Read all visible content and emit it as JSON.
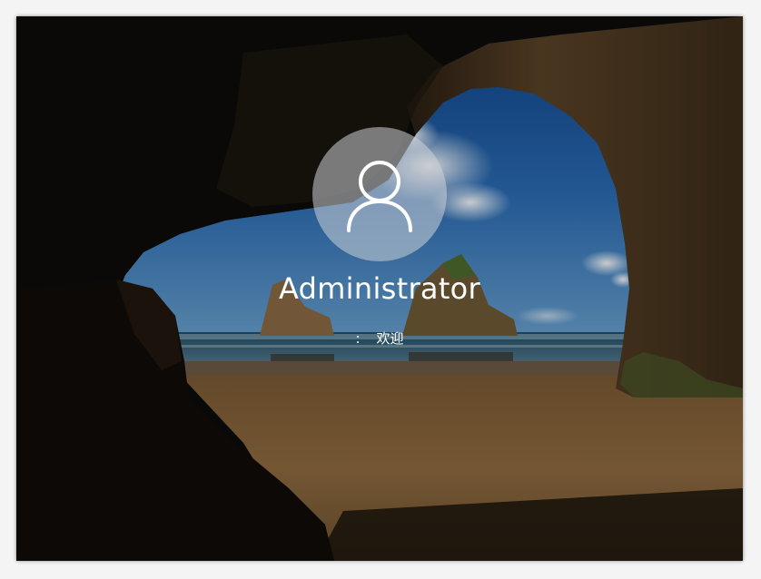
{
  "login": {
    "username": "Administrator",
    "status_prefix": ":",
    "status_text": "欢迎"
  },
  "icons": {
    "avatar": "user-silhouette-icon"
  },
  "colors": {
    "text": "#ffffff",
    "avatar_circle": "#cdd2d7"
  }
}
